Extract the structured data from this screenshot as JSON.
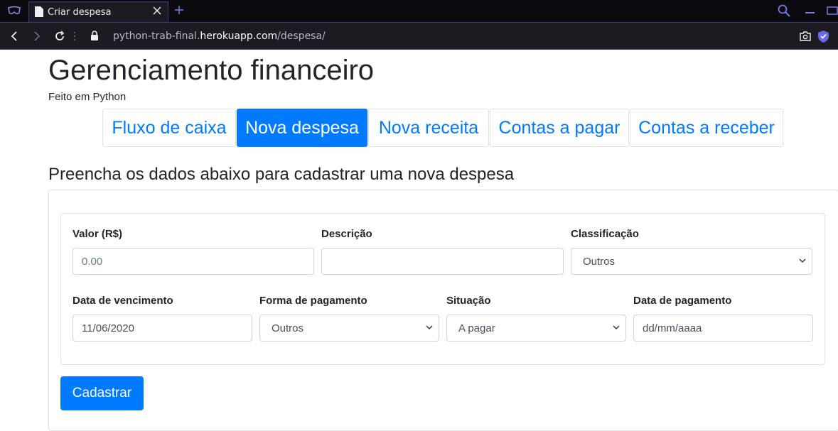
{
  "browser": {
    "tab_title": "Criar despesa",
    "url_prefix": "python-trab-final.",
    "url_domain": "herokuapp.com",
    "url_path": "/despesa/"
  },
  "page": {
    "title": "Gerenciamento financeiro",
    "subtitle": "Feito em Python",
    "section_title": "Preencha os dados abaixo para cadastrar uma nova despesa"
  },
  "nav": [
    {
      "label": "Fluxo de caixa",
      "active": false
    },
    {
      "label": "Nova despesa",
      "active": true
    },
    {
      "label": "Nova receita",
      "active": false
    },
    {
      "label": "Contas a pagar",
      "active": false
    },
    {
      "label": "Contas a receber",
      "active": false
    }
  ],
  "form": {
    "valor": {
      "label": "Valor (R$)",
      "placeholder": "0.00"
    },
    "descricao": {
      "label": "Descrição",
      "value": ""
    },
    "classificacao": {
      "label": "Classificação",
      "value": "Outros"
    },
    "data_vencimento": {
      "label": "Data de vencimento",
      "value": "11/06/2020"
    },
    "forma_pagamento": {
      "label": "Forma de pagamento",
      "value": "Outros"
    },
    "situacao": {
      "label": "Situação",
      "value": "A pagar"
    },
    "data_pagamento": {
      "label": "Data de pagamento",
      "placeholder": "dd/mm/aaaa"
    },
    "submit_label": "Cadastrar"
  },
  "colors": {
    "primary": "#007bff",
    "chrome_accent": "#7a78e8"
  }
}
